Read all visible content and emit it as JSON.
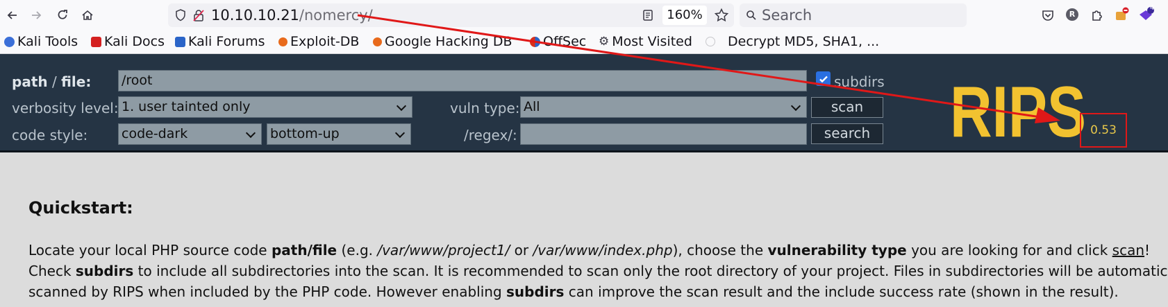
{
  "browser": {
    "url_host": "10.10.10.21",
    "url_path": "/nomercy/",
    "zoom": "160%",
    "search_placeholder": "Search",
    "profile_initial": "R",
    "extension_badge": "4"
  },
  "bookmarks": [
    {
      "label": "Kali Tools",
      "icon_color": "#3b6fd8"
    },
    {
      "label": "Kali Docs",
      "icon_color": "#d42020"
    },
    {
      "label": "Kali Forums",
      "icon_color": "#2a64c8"
    },
    {
      "label": "Exploit-DB",
      "icon_color": "#e86a1c"
    },
    {
      "label": "Google Hacking DB",
      "icon_color": "#e86a1c"
    },
    {
      "label": "OffSec",
      "icon_color": "#d8301c"
    },
    {
      "label": "Most Visited",
      "icon": "gear-icon"
    },
    {
      "label": "Decrypt MD5, SHA1, ...",
      "icon": "globe-icon"
    }
  ],
  "rips": {
    "path_label_bold": "path",
    "path_label_sep": " / ",
    "path_label_file": "file:",
    "path_value": "/root",
    "subdirs_label": "subdirs",
    "subdirs_checked": true,
    "verbosity_label": "verbosity level:",
    "verbosity_value": "1. user tainted only",
    "vuln_label": "vuln type:",
    "vuln_value": "All",
    "scan_label": "scan",
    "code_style_label": "code style:",
    "code_style_value": "code-dark",
    "order_value": "bottom-up",
    "regex_label": "/regex/:",
    "regex_value": "",
    "search_label": "search",
    "logo_text": "RIPS",
    "version": "0.53",
    "colors": {
      "header_bg": "#253444",
      "logo": "#f2c230",
      "annotation": "#e01818"
    }
  },
  "quickstart": {
    "title": "Quickstart:",
    "l1_a": "Locate your local PHP source code ",
    "l1_b": "path/file",
    "l1_c": " (e.g. ",
    "l1_d": "/var/www/project1/",
    "l1_e": " or ",
    "l1_f": "/var/www/index.php",
    "l1_g": "), choose the ",
    "l1_h": "vulnerability type",
    "l1_i": " you are looking for and click ",
    "l1_j": "scan",
    "l1_k": "!",
    "l2_a": "Check ",
    "l2_b": "subdirs",
    "l2_c": " to include all subdirectories into the scan. It is recommended to scan only the root directory of your project. Files in subdirectories will be automatically",
    "l3_a": "scanned by RIPS when included by the PHP code. However enabling ",
    "l3_b": "subdirs",
    "l3_c": " can improve the scan result and the include success rate (shown in the result)."
  }
}
